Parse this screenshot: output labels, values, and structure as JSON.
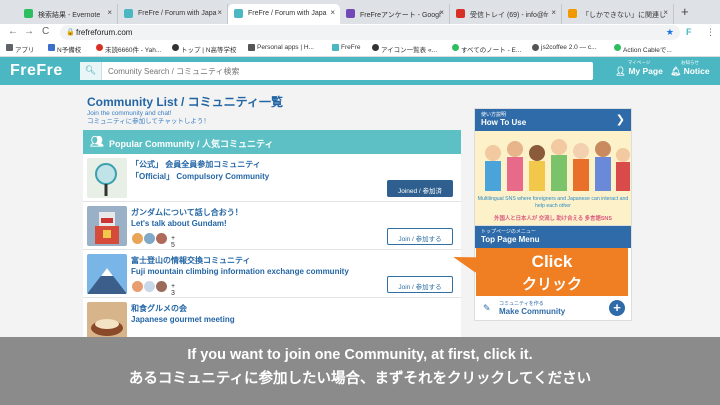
{
  "browser": {
    "tabs": [
      {
        "label": "検索結果 - Evernote",
        "color": "#2dbe60"
      },
      {
        "label": "FreFre / Forum with Japa",
        "color": "#4ab7c2"
      },
      {
        "label": "FreFre / Forum with Japa",
        "color": "#4ab7c2"
      },
      {
        "label": "FreFreアンケート - Googl",
        "color": "#7248b9"
      },
      {
        "label": "受信トレイ (69) - info@fr",
        "color": "#d93025"
      },
      {
        "label": "「しかできない」に関連し",
        "color": "#f29900"
      }
    ],
    "new_tab_glyph": "+",
    "close_glyph": "×",
    "url": "frefreforum.com",
    "back_glyph": "←",
    "forward_glyph": "→",
    "reload_glyph": "C",
    "bookmarks": [
      {
        "label": "アプリ",
        "color": "#5f6368"
      },
      {
        "label": "N予備校",
        "color": "#3b6fc9"
      },
      {
        "label": "未読6660件 - Yah...",
        "color": "#d93025"
      },
      {
        "label": "トップ | N高等学校",
        "color": "#333333"
      },
      {
        "label": "Personal apps | H...",
        "color": "#555555"
      },
      {
        "label": "FreFre",
        "color": "#4ab7c2"
      },
      {
        "label": "アイコン一覧表 «...",
        "color": "#333333"
      },
      {
        "label": "すべてのノート - E...",
        "color": "#2dbe60"
      },
      {
        "label": "js2coffee 2.0 — c...",
        "color": "#555555"
      },
      {
        "label": "Action Cableで...",
        "color": "#2dbe60"
      }
    ]
  },
  "header": {
    "logo": "FreFre",
    "search_placeholder": "Comunity Search / コミュニティ検索",
    "my_page_sub": "マイページ",
    "my_page": "My Page",
    "notice_sub": "お知らせ",
    "notice": "Notice"
  },
  "main": {
    "title": "Community List / コミュニティ一覧",
    "subtitle_en": "Join the community and chat!",
    "subtitle_jp": "コミュニティに参加してチャットしよう！",
    "popular_heading": "Popular Community / 人気コミュニティ",
    "communities": [
      {
        "jp": "「公式」 会員全員参加コミュニティ",
        "en": "「Official」 Compulsory Community",
        "members": "",
        "button": "Joined / 参加済",
        "joined": true
      },
      {
        "jp": "ガンダムについて話し合おう！",
        "en": "Let's talk about Gundam!",
        "members": "+ 5",
        "button": "Join / 参加する",
        "joined": false
      },
      {
        "jp": "富士登山の情報交換コミュニティ",
        "en": "Fuji mountain climbing information exchange community",
        "members": "+ 3",
        "button": "Join / 参加する",
        "joined": false
      },
      {
        "jp": "和食グルメの会",
        "en": "Japanese gourmet meeting",
        "members": "",
        "button": "",
        "joined": false
      }
    ]
  },
  "sidebar": {
    "howto_sub": "使い方説明",
    "howto": "How To Use",
    "howto_caption_en": "Multilingual SNS where foreigners and Japanese can interact and help each other",
    "howto_caption_jp": "外国人と日本人が 交流し 助け合える 多言語SNS",
    "topmenu_sub": "トップページのメニュー",
    "topmenu": "Top Page Menu",
    "make_sub": "コミュニティを作る",
    "make": "Make Community"
  },
  "callout": {
    "line1": "Click",
    "line2": "クリック",
    "color": "#f07f24"
  },
  "caption": {
    "line1": "If you want to join one Community, at first, click it.",
    "line2": "あるコミュニティに参加したい場合、まずそれをクリックしてください"
  },
  "colors": {
    "brand": "#4ab7c2",
    "link": "#2466a5",
    "joined_button": "#2e5f8e"
  }
}
